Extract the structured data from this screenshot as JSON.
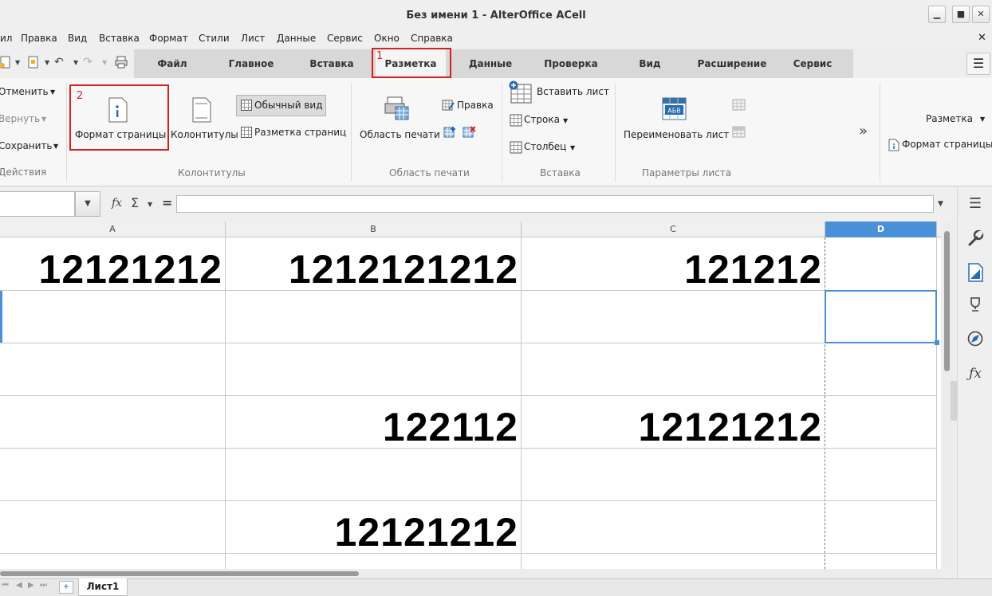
{
  "window": {
    "title": "Без имени 1 - AlterOffice ACell",
    "minimize_label": "▁",
    "maximize_label": "■",
    "close_label": "✕",
    "doc_close_label": "✕"
  },
  "menu": [
    "ил",
    "Правка",
    "Вид",
    "Вставка",
    "Формат",
    "Стили",
    "Лист",
    "Данные",
    "Сервис",
    "Окно",
    "Справка"
  ],
  "tabs": [
    "Файл",
    "Главное",
    "Вставка",
    "Разметка",
    "Данные",
    "Проверка",
    "Вид",
    "Расширение",
    "Сервис"
  ],
  "active_tab": "Разметка",
  "annotations": {
    "first": "1",
    "second": "2"
  },
  "ribbon": {
    "actions": {
      "undo": "Отменить",
      "redo": "Вернуть",
      "save": "Сохранить",
      "group_label": "Действия"
    },
    "headers_footers": {
      "page_format": "Формат страницы",
      "headers": "Колонтитулы",
      "normal_view": "Обычный вид",
      "page_layout": "Разметка страниц",
      "group_label": "Колонтитулы"
    },
    "print_area": {
      "print_area": "Область печати",
      "edit": "Правка",
      "group_label": "Область печати"
    },
    "insert": {
      "insert_sheet": "Вставить лист",
      "row": "Строка",
      "column": "Столбец",
      "group_label": "Вставка"
    },
    "sheet_params": {
      "rename_sheet": "Переименовать лист",
      "group_label": "Параметры листа"
    },
    "more_label": "»",
    "overflow": {
      "layout_dropdown": "Разметка",
      "page_format": "Формат страницы"
    }
  },
  "formula_bar": {
    "name_box": "",
    "fx": "fx",
    "sum": "Σ",
    "equals": "=",
    "formula": ""
  },
  "grid": {
    "columns": [
      "A",
      "B",
      "C",
      "D"
    ],
    "selected_column": "D",
    "rows": [
      [
        "12121212",
        "1212121212",
        "121212",
        ""
      ],
      [
        "",
        "",
        "",
        ""
      ],
      [
        "",
        "",
        "",
        ""
      ],
      [
        "",
        "122112",
        "12121212",
        ""
      ],
      [
        "",
        "",
        "",
        ""
      ],
      [
        "",
        "12121212",
        "",
        ""
      ]
    ]
  },
  "sheets": [
    "Лист1"
  ],
  "add_sheet_label": "+",
  "sidebar": [
    "menu-icon",
    "wrench-icon",
    "page-properties-icon",
    "trophy-icon",
    "navigator-icon",
    "functions-icon"
  ]
}
